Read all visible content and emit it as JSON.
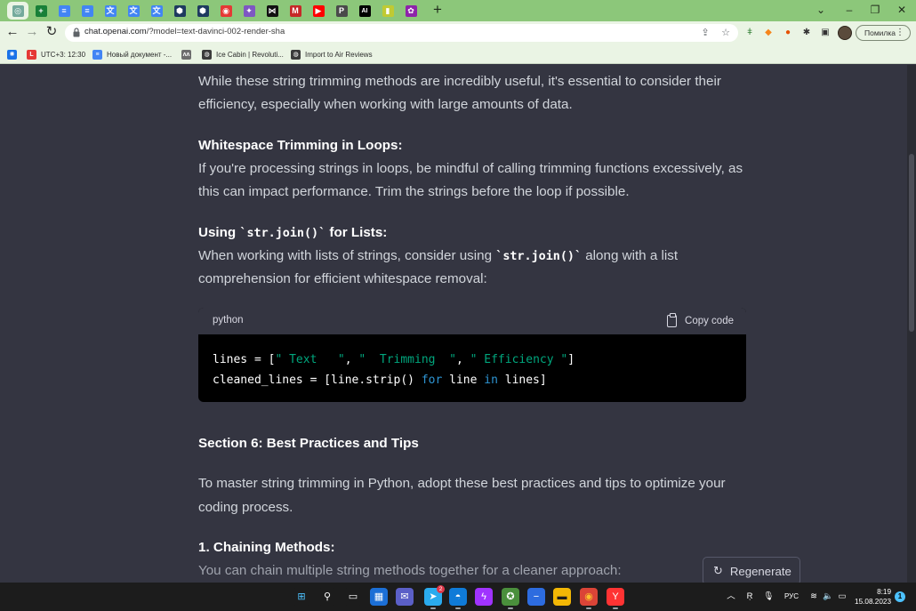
{
  "browser": {
    "tabs": [
      {
        "icon": "chatgpt-icon",
        "glyph": "◎",
        "color": "#74aa9c",
        "active": true
      },
      {
        "icon": "sheets-icon",
        "glyph": "+",
        "color": "#188038"
      },
      {
        "icon": "docs-icon",
        "glyph": "≡",
        "color": "#4285f4"
      },
      {
        "icon": "docs-icon",
        "glyph": "≡",
        "color": "#4285f4"
      },
      {
        "icon": "translate-icon",
        "glyph": "文",
        "color": "#4285f4"
      },
      {
        "icon": "translate-icon",
        "glyph": "文",
        "color": "#4285f4"
      },
      {
        "icon": "translate-icon",
        "glyph": "文",
        "color": "#4285f4"
      },
      {
        "icon": "shield-icon",
        "glyph": "⬢",
        "color": "#1e3a5f"
      },
      {
        "icon": "shield-icon",
        "glyph": "⬢",
        "color": "#1e3a5f"
      },
      {
        "icon": "target-icon",
        "glyph": "◉",
        "color": "#e53935"
      },
      {
        "icon": "star-icon",
        "glyph": "✦",
        "color": "#7e57c2"
      },
      {
        "icon": "bowtie-icon",
        "glyph": "⋈",
        "color": "#111111"
      },
      {
        "icon": "m-icon",
        "glyph": "M",
        "color": "#c62828"
      },
      {
        "icon": "youtube-icon",
        "glyph": "▶",
        "color": "#ff0000"
      },
      {
        "icon": "p-icon",
        "glyph": "P",
        "color": "#4a4a4a"
      },
      {
        "icon": "ai-icon",
        "glyph": "AI",
        "color": "#000000"
      },
      {
        "icon": "bookmark-icon",
        "glyph": "▮",
        "color": "#c0ca33"
      },
      {
        "icon": "flower-icon",
        "glyph": "✿",
        "color": "#8e24aa"
      }
    ],
    "new_tab": "+",
    "window_controls": {
      "dropdown": "⌄",
      "minimize": "–",
      "restore": "❐",
      "close": "✕"
    },
    "nav": {
      "back": "←",
      "forward": "→",
      "reload": "↻"
    },
    "url_host": "chat.openai.com",
    "url_path": "/?model=text-davinci-002-render-sha",
    "omnibox_icons": {
      "share": "⇪",
      "bookmark": "☆"
    },
    "extensions": [
      {
        "icon": "dropper-icon",
        "glyph": "ǂ",
        "color": "#2e7d32"
      },
      {
        "icon": "metamask-icon",
        "glyph": "◆",
        "color": "#f6851b"
      },
      {
        "icon": "ext-multicolor-icon",
        "glyph": "●",
        "color": "#e65100"
      },
      {
        "icon": "puzzle-icon",
        "glyph": "✱",
        "color": "#333333"
      },
      {
        "icon": "sidepanel-icon",
        "glyph": "▣",
        "color": "#333333"
      }
    ],
    "error_button": "Помилка",
    "error_dots": "⋮",
    "bookmarks": [
      {
        "icon": "apps-icon",
        "glyph": "✺",
        "color": "#1a73e8",
        "label": ""
      },
      {
        "icon": "l-icon",
        "glyph": "L",
        "color": "#e53935",
        "label": "UTC+3: 12:30"
      },
      {
        "icon": "docs-icon",
        "glyph": "≡",
        "color": "#4285f4",
        "label": "Новый документ -..."
      },
      {
        "icon": "mountain-icon",
        "glyph": "ᴧᴧ",
        "color": "#6d6d6d",
        "label": ""
      },
      {
        "icon": "globe-icon",
        "glyph": "◍",
        "color": "#3b3b3b",
        "label": "Ice Cabin | Revoluti..."
      },
      {
        "icon": "globe-icon",
        "glyph": "◍",
        "color": "#3b3b3b",
        "label": "Import to Air Reviews"
      }
    ]
  },
  "chat": {
    "p1_line1": "While these string trimming methods are incredibly useful, it's essential to consider their",
    "p1_line2": "efficiency, especially when working with large amounts of data.",
    "h1": "Whitespace Trimming in Loops:",
    "p2_line1": "If you're processing strings in loops, be mindful of calling trimming functions excessively, as",
    "p2_line2": "this can impact performance. Trim the strings before the loop if possible.",
    "h2_prefix": "Using ",
    "h2_code": "`str.join()`",
    "h2_suffix": " for Lists:",
    "p3_prefix": "When working with lists of strings, consider using ",
    "p3_code": "`str.join()`",
    "p3_suffix": " along with a list",
    "p3_line2": "comprehension for efficient whitespace removal:",
    "code_language": "python",
    "copy_code_label": "Copy code",
    "code": {
      "l1_a": "lines = [",
      "l1_s1": "\" Text   \"",
      "l1_b": ", ",
      "l1_s2": "\"  Trimming  \"",
      "l1_c": ", ",
      "l1_s3": "\" Efficiency \"",
      "l1_d": "]",
      "l2_a": "cleaned_lines = [line.strip() ",
      "l2_kw1": "for",
      "l2_b": " line ",
      "l2_kw2": "in",
      "l2_c": " lines]"
    },
    "section_heading": "Section 6: Best Practices and Tips",
    "p4_line1": "To master string trimming in Python, adopt these best practices and tips to optimize your",
    "p4_line2": "coding process.",
    "h3": "1. Chaining Methods:",
    "p5_line1": "You can chain multiple string methods together for a cleaner approach:",
    "regenerate_label": "Regenerate",
    "regenerate_icon": "↻"
  },
  "taskbar": {
    "apps": [
      {
        "name": "start-button",
        "glyph": "⊞",
        "color": "#1c1c1c",
        "fg": "#4cc2ff"
      },
      {
        "name": "search-button",
        "glyph": "⚲",
        "color": "#1c1c1c",
        "fg": "#ffffff"
      },
      {
        "name": "task-view-button",
        "glyph": "▭",
        "color": "#1c1c1c",
        "fg": "#ffffff"
      },
      {
        "name": "widgets-button",
        "glyph": "▦",
        "color": "#1c6fd6",
        "fg": "#ffffff"
      },
      {
        "name": "teams-chat-button",
        "glyph": "✉",
        "color": "#5b5fc7",
        "fg": "#ffffff"
      },
      {
        "name": "telegram-button",
        "glyph": "➤",
        "color": "#2aabee",
        "fg": "#ffffff",
        "badge": "2"
      },
      {
        "name": "edge-button",
        "glyph": "◓",
        "color": "#0f7bd8",
        "fg": "#ffffff"
      },
      {
        "name": "messenger-button",
        "glyph": "ϟ",
        "color": "#a033ff",
        "fg": "#ffffff"
      },
      {
        "name": "chrome-settings-button",
        "glyph": "✪",
        "color": "#4a8f3c",
        "fg": "#ffffff"
      },
      {
        "name": "minus-app-button",
        "glyph": "−",
        "color": "#2d6cdf",
        "fg": "#ffffff"
      },
      {
        "name": "file-explorer-button",
        "glyph": "▬",
        "color": "#f2b705",
        "fg": "#1c1c1c"
      },
      {
        "name": "chrome-button",
        "glyph": "◉",
        "color": "#db4437",
        "fg": "#fbc02d"
      },
      {
        "name": "yandex-button",
        "glyph": "Y",
        "color": "#f33",
        "fg": "#ffffff"
      }
    ],
    "tray_chevron": "︿",
    "tray_keyboard": "Ŗ",
    "tray_mic": "🎙",
    "language": "РУС",
    "wifi": "≋",
    "volume": "🔈",
    "battery": "▭",
    "time": "8:19",
    "date": "15.08.2023",
    "notification_count": "1"
  }
}
